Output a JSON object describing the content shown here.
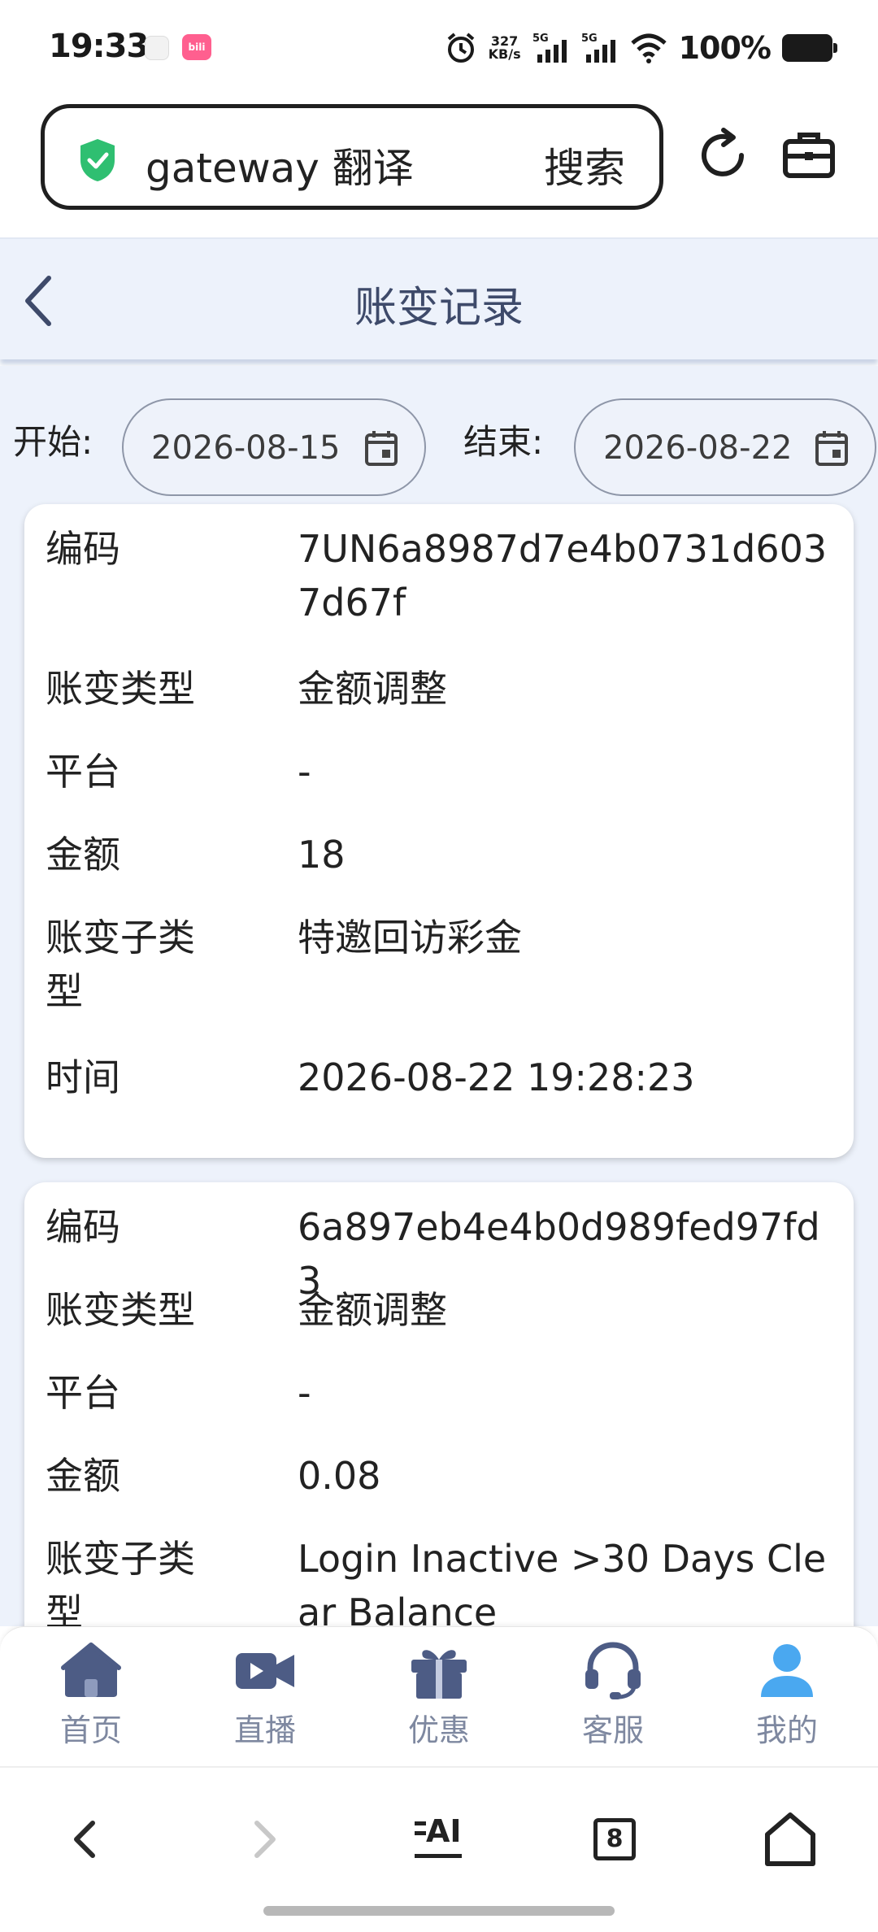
{
  "status_bar": {
    "time": "19:33",
    "app_badge": "bilibili",
    "net_speed_value": "327",
    "net_speed_unit": "KB/s",
    "sim1": "5G",
    "sim2": "5G",
    "battery": "100%"
  },
  "browser": {
    "search_text": "gateway 翻译",
    "search_button": "搜索"
  },
  "header": {
    "title": "账变记录"
  },
  "filter": {
    "start_label": "开始:",
    "start_value": "2026-08-15",
    "end_label": "结束:",
    "end_value": "2026-08-22"
  },
  "records": [
    {
      "code_label": "编码",
      "code": "7UN6a8987d7e4b0731d6037d67f",
      "type_label": "账变类型",
      "type": "金额调整",
      "platform_label": "平台",
      "platform": "-",
      "amount_label": "金额",
      "amount": "18",
      "subtype_label": "账变子类型",
      "subtype": "特邀回访彩金",
      "time_label": "时间",
      "time": "2026-08-22 19:28:23"
    },
    {
      "code_label": "编码",
      "code": "6a897eb4e4b0d989fed97fd3",
      "type_label": "账变类型",
      "type": "金额调整",
      "platform_label": "平台",
      "platform": "-",
      "amount_label": "金额",
      "amount": "0.08",
      "subtype_label": "账变子类型",
      "subtype": "Login Inactive >30 Days Clear Balance"
    }
  ],
  "tabbar": {
    "tabs": [
      {
        "label": "首页",
        "icon": "home-icon"
      },
      {
        "label": "直播",
        "icon": "video-camera-icon"
      },
      {
        "label": "优惠",
        "icon": "gift-icon"
      },
      {
        "label": "客服",
        "icon": "headset-icon"
      },
      {
        "label": "我的",
        "icon": "user-icon"
      }
    ]
  },
  "navbar": {
    "tabs_count": "8",
    "ai_label": "AI"
  },
  "colors": {
    "page_bg": "#edf2fb",
    "accent_green": "#2fbf71",
    "tab_icon": "#4d5c85",
    "tab_active": "#4aa8f0"
  }
}
